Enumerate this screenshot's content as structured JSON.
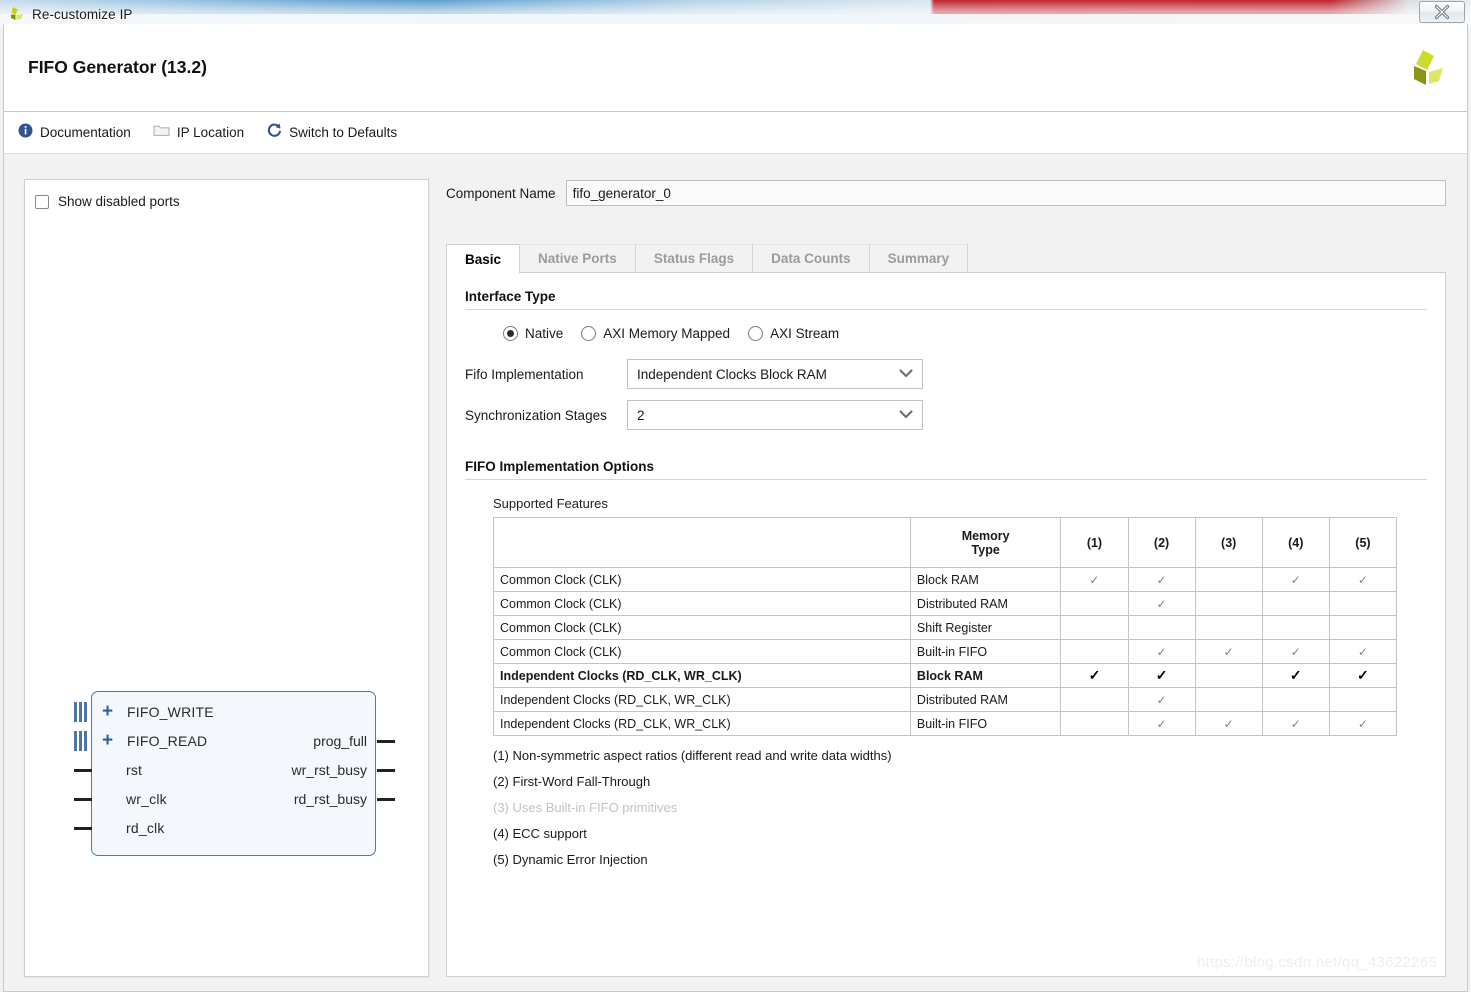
{
  "window": {
    "title": "Re-customize IP",
    "close_label": "X",
    "close_icon": "close-icon",
    "app_icon": "xilinx-logo-icon"
  },
  "header": {
    "product_title": "FIFO Generator (13.2)",
    "logo_icon": "xilinx-pinwheel-logo"
  },
  "toolbar": {
    "items": [
      {
        "label": "Documentation",
        "icon": "info-circle-icon"
      },
      {
        "label": "IP Location",
        "icon": "folder-icon"
      },
      {
        "label": "Switch to Defaults",
        "icon": "refresh-circular-arrow-icon"
      }
    ]
  },
  "left_panel": {
    "show_disabled_ports": {
      "label": "Show disabled ports",
      "checked": false
    },
    "symbol": {
      "bus_ports": [
        {
          "name": "FIFO_WRITE",
          "expander": "+"
        },
        {
          "name": "FIFO_READ",
          "expander": "+"
        }
      ],
      "input_ports": [
        "rst",
        "wr_clk",
        "rd_clk"
      ],
      "output_ports": [
        "prog_full",
        "wr_rst_busy",
        "rd_rst_busy"
      ]
    }
  },
  "component": {
    "label": "Component Name",
    "value": "fifo_generator_0",
    "placeholder": ""
  },
  "tabs": [
    {
      "label": "Basic",
      "active": true
    },
    {
      "label": "Native Ports",
      "active": false
    },
    {
      "label": "Status Flags",
      "active": false
    },
    {
      "label": "Data Counts",
      "active": false
    },
    {
      "label": "Summary",
      "active": false
    }
  ],
  "interface_type": {
    "group_title": "Interface Type",
    "options": [
      {
        "label": "Native",
        "selected": true
      },
      {
        "label": "AXI Memory Mapped",
        "selected": false
      },
      {
        "label": "AXI Stream",
        "selected": false
      }
    ],
    "selects": [
      {
        "label": "Fifo Implementation",
        "value": "Independent Clocks Block RAM",
        "icon": "chevron-down-icon"
      },
      {
        "label": "Synchronization Stages",
        "value": "2",
        "icon": "chevron-down-icon"
      }
    ]
  },
  "fifo_options": {
    "group_title": "FIFO Implementation Options",
    "features_label": "Supported Features",
    "table": {
      "headers": [
        "",
        "Memory\nType",
        "(1)",
        "(2)",
        "(3)",
        "(4)",
        "(5)"
      ],
      "header_memory_type_line1": "Memory",
      "header_memory_type_line2": "Type",
      "header_cols": [
        "(1)",
        "(2)",
        "(3)",
        "(4)",
        "(5)"
      ],
      "tick_glyph": "✓",
      "rows": [
        {
          "feature": "Common Clock (CLK)",
          "memory_type": "Block RAM",
          "marks": [
            true,
            true,
            false,
            true,
            true
          ],
          "highlight": false
        },
        {
          "feature": "Common Clock (CLK)",
          "memory_type": "Distributed RAM",
          "marks": [
            false,
            true,
            false,
            false,
            false
          ],
          "highlight": false
        },
        {
          "feature": "Common Clock (CLK)",
          "memory_type": "Shift Register",
          "marks": [
            false,
            false,
            false,
            false,
            false
          ],
          "highlight": false
        },
        {
          "feature": "Common Clock (CLK)",
          "memory_type": "Built-in FIFO",
          "marks": [
            false,
            true,
            true,
            true,
            true
          ],
          "highlight": false
        },
        {
          "feature": "Independent Clocks (RD_CLK, WR_CLK)",
          "memory_type": "Block RAM",
          "marks": [
            true,
            true,
            false,
            true,
            true
          ],
          "highlight": true
        },
        {
          "feature": "Independent Clocks (RD_CLK, WR_CLK)",
          "memory_type": "Distributed RAM",
          "marks": [
            false,
            true,
            false,
            false,
            false
          ],
          "highlight": false
        },
        {
          "feature": "Independent Clocks (RD_CLK, WR_CLK)",
          "memory_type": "Built-in FIFO",
          "marks": [
            false,
            true,
            true,
            true,
            true
          ],
          "highlight": false
        }
      ]
    },
    "footnotes": [
      {
        "text": "(1) Non-symmetric aspect ratios (different read and write data widths)",
        "disabled": false
      },
      {
        "text": "(2) First-Word Fall-Through",
        "disabled": false
      },
      {
        "text": "(3) Uses Built-in FIFO primitives",
        "disabled": true
      },
      {
        "text": "(4) ECC support",
        "disabled": false
      },
      {
        "text": "(5) Dynamic Error Injection",
        "disabled": false
      }
    ]
  },
  "watermark": {
    "text": "https://blog.csdn.net/qq_43622265"
  },
  "colors": {
    "accent_blue": "#2e5f9e",
    "logo_green": "#c8d400",
    "logo_olive": "#8a9000",
    "tab_active_text": "#000000",
    "tab_inactive_text": "#9b9b9b",
    "disabled_text": "#c3c3c3",
    "panel_bg": "#ffffff",
    "body_bg": "#f2f2f2",
    "symbol_fill": "#f4f8fd",
    "symbol_border": "#4f77a8"
  }
}
